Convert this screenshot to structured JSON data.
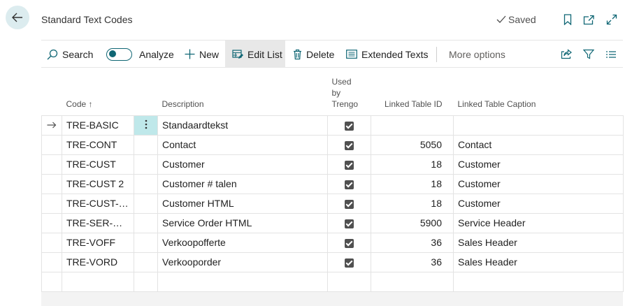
{
  "header": {
    "title": "Standard Text Codes",
    "status": "Saved"
  },
  "toolbar": {
    "search": "Search",
    "analyze": "Analyze",
    "new": "New",
    "edit_list": "Edit List",
    "delete": "Delete",
    "extended_texts": "Extended Texts",
    "more_options": "More options"
  },
  "table": {
    "columns": {
      "code": "Code ↑",
      "description": "Description",
      "used_by_1": "Used",
      "used_by_2": "by",
      "used_by_3": "Trengo",
      "linked_table_id": "Linked Table ID",
      "linked_table_caption": "Linked Table Caption"
    },
    "rows": [
      {
        "code": "TRE-BASIC",
        "description": "Standaardtekst",
        "used_by_trengo": true,
        "linked_table_id": "",
        "linked_table_caption": ""
      },
      {
        "code": "TRE-CONT",
        "description": "Contact",
        "used_by_trengo": true,
        "linked_table_id": "5050",
        "linked_table_caption": "Contact"
      },
      {
        "code": "TRE-CUST",
        "description": "Customer",
        "used_by_trengo": true,
        "linked_table_id": "18",
        "linked_table_caption": "Customer"
      },
      {
        "code": "TRE-CUST 2",
        "description": "Customer # talen",
        "used_by_trengo": true,
        "linked_table_id": "18",
        "linked_table_caption": "Customer"
      },
      {
        "code": "TRE-CUST-HT…",
        "description": "Customer HTML",
        "used_by_trengo": true,
        "linked_table_id": "18",
        "linked_table_caption": "Customer"
      },
      {
        "code": "TRE-SER-ORD",
        "description": "Service Order HTML",
        "used_by_trengo": true,
        "linked_table_id": "5900",
        "linked_table_caption": "Service Header"
      },
      {
        "code": "TRE-VOFF",
        "description": "Verkoopofferte",
        "used_by_trengo": true,
        "linked_table_id": "36",
        "linked_table_caption": "Sales Header"
      },
      {
        "code": "TRE-VORD",
        "description": "Verkooporder",
        "used_by_trengo": true,
        "linked_table_id": "36",
        "linked_table_caption": "Sales Header"
      }
    ]
  },
  "icons": {
    "back": "arrow-left-icon",
    "saved": "check-icon",
    "bookmark": "bookmark-icon",
    "open_new": "open-in-new-window-icon",
    "expand": "expand-icon",
    "search": "search-icon",
    "new": "plus-icon",
    "edit_list": "edit-list-icon",
    "delete": "trash-icon",
    "extended_texts": "text-lines-icon",
    "share": "share-icon",
    "filter": "filter-icon",
    "list_view": "list-view-icon",
    "row_selected": "arrow-right-icon",
    "row_menu": "vertical-dots-icon"
  },
  "colors": {
    "accent": "#0f6674",
    "back_bg": "#dcecef",
    "active_cell": "#bfe8ea"
  }
}
